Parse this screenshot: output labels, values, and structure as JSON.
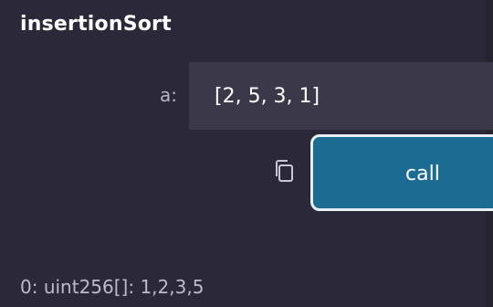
{
  "function": {
    "name": "insertionSort"
  },
  "params": [
    {
      "label": "a:",
      "value": "[2, 5, 3, 1]"
    }
  ],
  "actions": {
    "call_label": "call",
    "copy_icon": "copy-icon"
  },
  "output": {
    "text": "0: uint256[]: 1,2,3,5"
  },
  "colors": {
    "background": "#2b2939",
    "input_bg": "#3a3849",
    "button_bg": "#1b6b93",
    "button_border": "#e8eef5"
  }
}
